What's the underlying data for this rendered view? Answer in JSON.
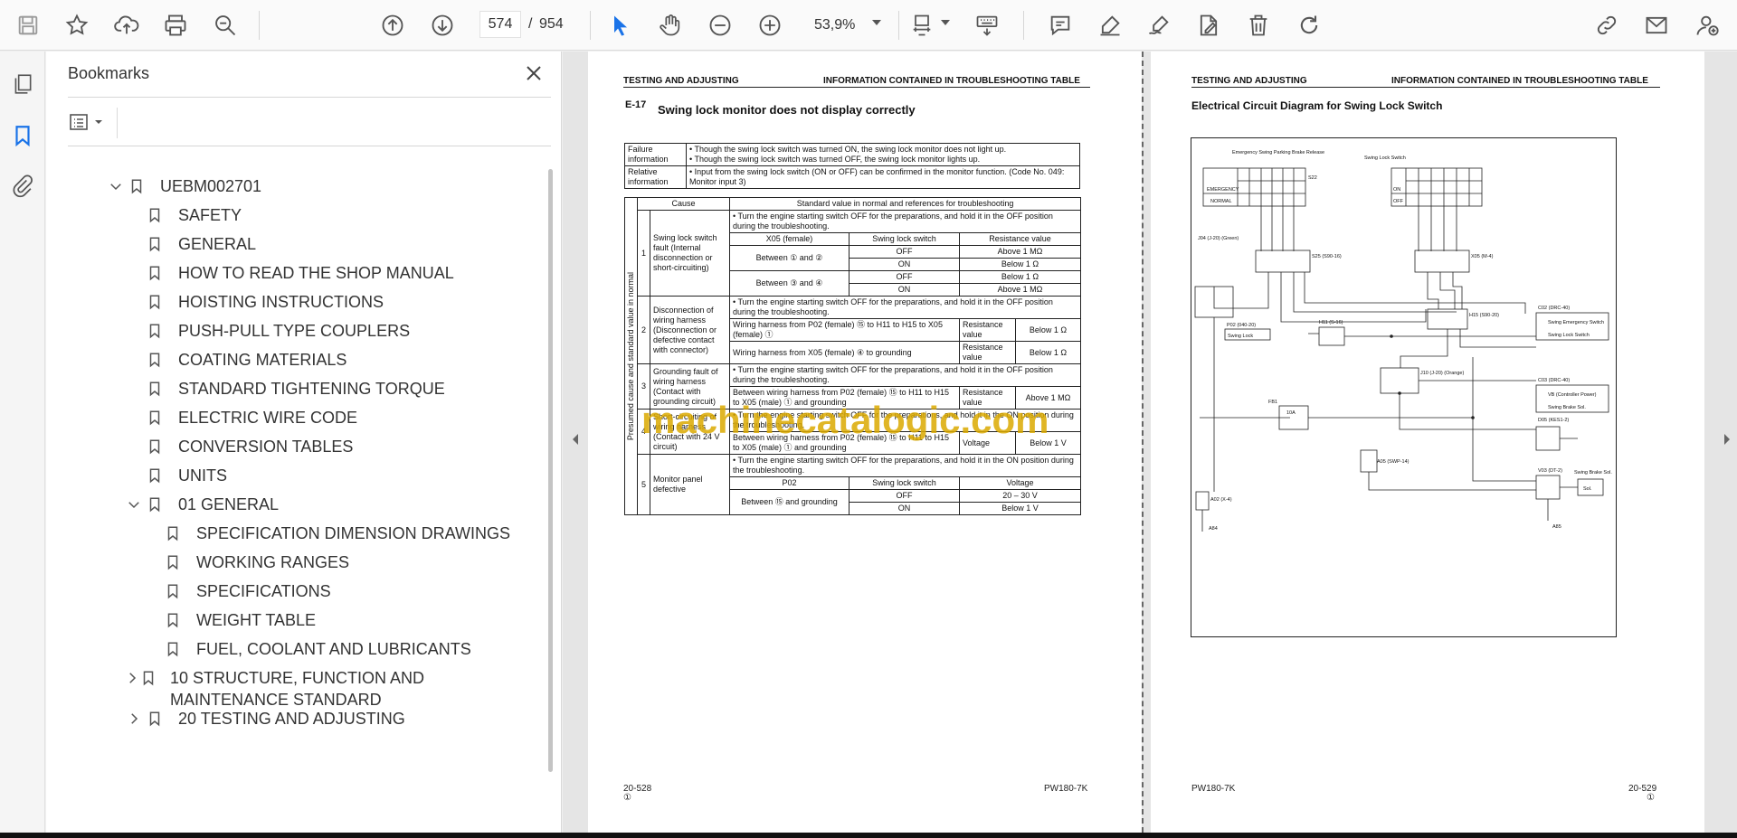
{
  "toolbar": {
    "current_page": "574",
    "page_separator": "/",
    "total_pages": "954",
    "zoom": "53,9%"
  },
  "icons": [
    "save-icon",
    "star-icon",
    "upload-icon",
    "print-icon",
    "search-zoom-icon",
    "arrow-up-icon",
    "arrow-down-icon",
    "cursor-icon",
    "hand-icon",
    "zoom-out-icon",
    "zoom-in-icon",
    "fit-page-icon",
    "keyboard-icon",
    "comment-icon",
    "highlight-icon",
    "sign-icon",
    "edit-file-icon",
    "trash-icon",
    "redo-icon",
    "link-icon",
    "mail-icon",
    "user-icon"
  ],
  "bookmarks": {
    "title": "Bookmarks",
    "items": [
      {
        "label": "UEBM002701",
        "level": 0,
        "expanded": true
      },
      {
        "label": "SAFETY",
        "level": 1
      },
      {
        "label": "GENERAL",
        "level": 1
      },
      {
        "label": "HOW TO READ THE SHOP MANUAL",
        "level": 1
      },
      {
        "label": "HOISTING INSTRUCTIONS",
        "level": 1
      },
      {
        "label": "PUSH-PULL TYPE COUPLERS",
        "level": 1
      },
      {
        "label": "COATING MATERIALS",
        "level": 1
      },
      {
        "label": "STANDARD TIGHTENING TORQUE",
        "level": 1
      },
      {
        "label": "ELECTRIC WIRE CODE",
        "level": 1
      },
      {
        "label": "CONVERSION TABLES",
        "level": 1
      },
      {
        "label": "UNITS",
        "level": 1
      },
      {
        "label": "01 GENERAL",
        "level": 1,
        "expanded": true
      },
      {
        "label": "SPECIFICATION DIMENSION DRAWINGS",
        "level": 2
      },
      {
        "label": "WORKING RANGES",
        "level": 2
      },
      {
        "label": "SPECIFICATIONS",
        "level": 2
      },
      {
        "label": "WEIGHT TABLE",
        "level": 2
      },
      {
        "label": "FUEL, COOLANT AND LUBRICANTS",
        "level": 2
      },
      {
        "label": "10 STRUCTURE, FUNCTION AND MAINTENANCE STANDARD",
        "level": 1,
        "expanded": false
      },
      {
        "label": "20 TESTING AND ADJUSTING",
        "level": 1,
        "expanded": false
      }
    ]
  },
  "left_page": {
    "header_left": "TESTING AND ADJUSTING",
    "header_right": "INFORMATION CONTAINED IN TROUBLESHOOTING TABLE",
    "code": "E-17",
    "title": "Swing lock monitor does not display correctly",
    "failure_info_label": "Failure information",
    "failure_info_1": "• Though the swing lock switch was turned ON, the swing lock monitor does not light up.",
    "failure_info_2": "• Though the swing lock switch was turned OFF, the swing lock monitor lights up.",
    "relative_info_label": "Relative information",
    "relative_info": "• Input from the swing lock switch (ON or OFF) can be confirmed in the monitor function. (Code No. 049: Monitor input 3)",
    "col_cause": "Cause",
    "col_standard": "Standard value in normal and references for troubleshooting",
    "side_label": "Presumed cause and standard value in normal",
    "prep_off": "• Turn the engine starting switch OFF for the preparations, and hold it in the OFF position during the troubleshooting.",
    "prep_on": "• Turn the engine starting switch OFF for the preparations, and hold it in the ON position during the troubleshooting.",
    "c1": "Swing lock switch fault (Internal disconnection or short-circuiting)",
    "c1_h1": "X05 (female)",
    "c1_h2": "Swing lock switch",
    "c1_h3": "Resistance value",
    "c1_r1": "Between ① and ②",
    "c1_r2": "Between ③ and ④",
    "off": "OFF",
    "on": "ON",
    "above1m": "Above 1 MΩ",
    "below1": "Below 1 Ω",
    "c2": "Disconnection of wiring harness (Disconnection or defective contact with connector)",
    "c2_a": "Wiring harness from P02 (female) ⑮ to H11 to H15 to X05 (female) ①",
    "c2_b": "Wiring harness from X05 (female) ④ to grounding",
    "resistance_value": "Resistance value",
    "c3": "Grounding fault of wiring harness (Contact with grounding circuit)",
    "c3_a": "Between wiring harness from P02 (female) ⑮ to H11 to H15 to X05 (male) ① and grounding",
    "c4": "Short-circuiting of wiring harness (Contact with 24 V circuit)",
    "c4_a": "Between wiring harness from P02 (female) ⑮ to H11 to H15 to X05 (male) ① and grounding",
    "voltage": "Voltage",
    "below1v": "Below 1 V",
    "c5": "Monitor panel defective",
    "c5_h1": "P02",
    "c5_h2": "Swing lock switch",
    "c5_h3": "Voltage",
    "c5_r": "Between ⑮ and grounding",
    "v20_30": "20 – 30 V",
    "n1": "1",
    "n2": "2",
    "n3": "3",
    "n4": "4",
    "n5": "5",
    "footer_left": "20-528",
    "footer_left_sub": "①",
    "footer_right": "PW180-7K"
  },
  "right_page": {
    "header_left": "TESTING AND ADJUSTING",
    "header_right": "INFORMATION CONTAINED IN TROUBLESHOOTING TABLE",
    "title": "Electrical Circuit Diagram for Swing Lock Switch",
    "labels": {
      "emergency_switch": "Emergency Swing Parking Brake Release",
      "swing_lock_switch": "Swing Lock Switch",
      "s22": "S22",
      "emergency": "EMERGENCY",
      "normal": "NORMAL",
      "on": "ON",
      "off": "OFF",
      "s25": "S25 (S90-16)",
      "x05": "X05 (M-4)",
      "j04": "J04 (J-20) (Green)",
      "h15": "H15 (S90-20)",
      "c02": "C02 (DRC-40)",
      "p02": "P02 (040-20)",
      "swing_lock": "Swing Lock",
      "h11": "H11 (S-16)",
      "sw_emergency": "Swing Emergency Switch",
      "sw_lock": "Swing Lock Switch",
      "j10": "J10 (J-20) (Orange)",
      "c03": "C03 (DRC-40)",
      "vb": "VB (Controller Power)",
      "swing_brake_sol": "Swing Brake Sol.",
      "fb1": "FB1",
      "fuse": "10A",
      "d05": "D05 (KES1-2)",
      "a05": "A05 (SWP-14)",
      "v03": "V03 (DT-2)",
      "swing_brake": "Swing Brake Sol.",
      "sol": "Sol.",
      "a02": "A02 (X-4)",
      "a84": "A84",
      "a85": "A85"
    },
    "footer_left": "PW180-7K",
    "footer_right": "20-529",
    "footer_right_sub": "①"
  },
  "watermark": "machinecatalogic.com"
}
